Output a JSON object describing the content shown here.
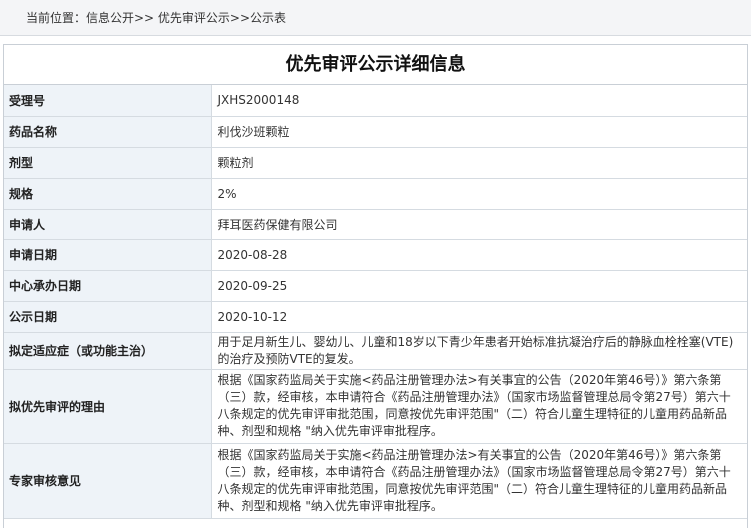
{
  "breadcrumb": {
    "text": "当前位置：信息公开>> 优先审评公示>>公示表"
  },
  "detail": {
    "title": "优先审评公示详细信息",
    "rows": [
      {
        "label": "受理号",
        "value": "JXHS2000148"
      },
      {
        "label": "药品名称",
        "value": "利伐沙班颗粒"
      },
      {
        "label": "剂型",
        "value": "颗粒剂"
      },
      {
        "label": "规格",
        "value": "2%"
      },
      {
        "label": "申请人",
        "value": "拜耳医药保健有限公司"
      },
      {
        "label": "申请日期",
        "value": "2020-08-28"
      },
      {
        "label": "中心承办日期",
        "value": "2020-09-25"
      },
      {
        "label": "公示日期",
        "value": "2020-10-12"
      },
      {
        "label": "拟定适应症（或功能主治）",
        "value": "用于足月新生儿、婴幼儿、儿童和18岁以下青少年患者开始标准抗凝治疗后的静脉血栓栓塞(VTE)的治疗及预防VTE的复发。"
      },
      {
        "label": "拟优先审评的理由",
        "value": "根据《国家药监局关于实施<药品注册管理办法>有关事宜的公告（2020年第46号）》第六条第（三）款，经审核，本申请符合《药品注册管理办法》（国家市场监督管理总局令第27号）第六十八条规定的优先审评审批范围，同意按优先审评范围\"（二）符合儿童生理特征的儿童用药品新品种、剂型和规格 \"纳入优先审评审批程序。"
      },
      {
        "label": "专家审核意见",
        "value": "根据《国家药监局关于实施<药品注册管理办法>有关事宜的公告（2020年第46号）》第六条第（三）款，经审核，本申请符合《药品注册管理办法》（国家市场监督管理总局令第27号）第六十八条规定的优先审评审批范围，同意按优先审评范围\"（二）符合儿童生理特征的儿童用药品新品种、剂型和规格 \"纳入优先审评审批程序。"
      }
    ]
  }
}
